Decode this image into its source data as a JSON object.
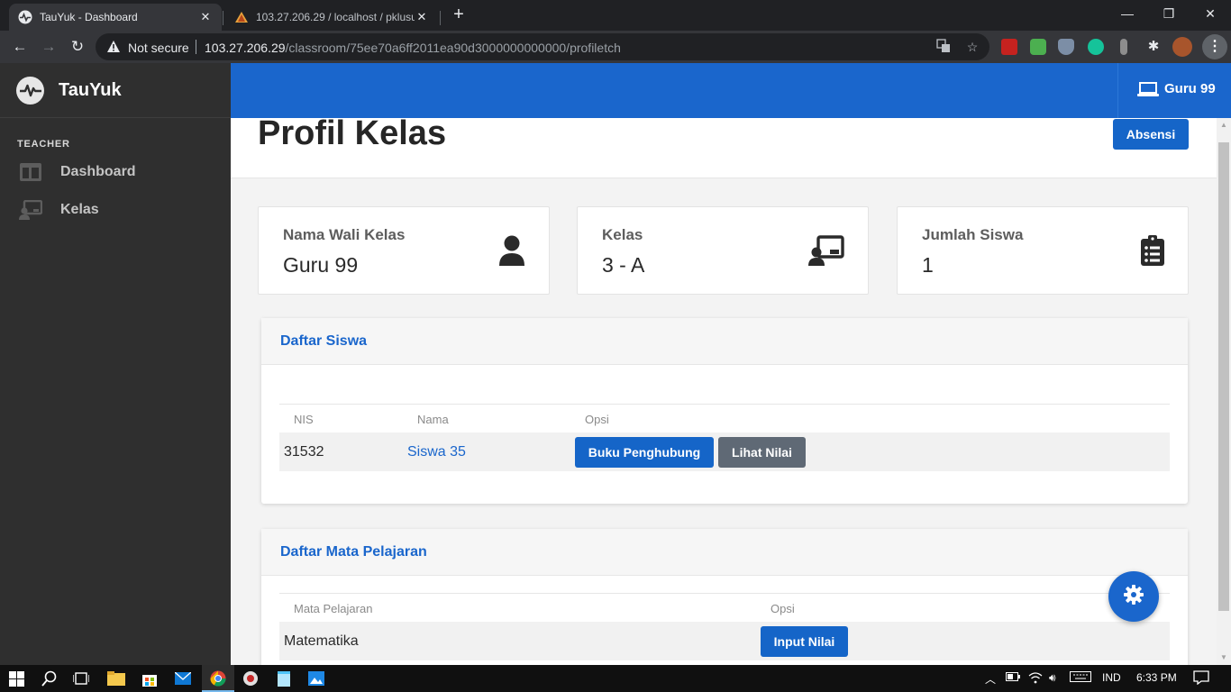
{
  "browser": {
    "tabs": [
      {
        "title": "TauYuk - Dashboard",
        "active": true
      },
      {
        "title": "103.27.206.29 / localhost / pklusu",
        "active": false
      }
    ],
    "omnibox": {
      "security": "Not secure",
      "host": "103.27.206.29",
      "path": "/classroom/75ee70a6ff2011ea90d3000000000000/profiletch"
    }
  },
  "app": {
    "brand": "TauYuk",
    "topbar_user": "Guru 99",
    "sidebar": {
      "heading": "TEACHER",
      "items": [
        {
          "label": "Dashboard",
          "icon": "dashboard-icon"
        },
        {
          "label": "Kelas",
          "icon": "classroom-icon"
        }
      ]
    }
  },
  "page": {
    "title": "Profil Kelas",
    "absensi_label": "Absensi",
    "stats": [
      {
        "label": "Nama Wali Kelas",
        "value": "Guru 99",
        "icon": "user-icon"
      },
      {
        "label": "Kelas",
        "value": "3 - A",
        "icon": "chalkboard-teacher-icon"
      },
      {
        "label": "Jumlah Siswa",
        "value": "1",
        "icon": "clipboard-list-icon"
      }
    ],
    "students": {
      "title": "Daftar Siswa",
      "columns": [
        "NIS",
        "Nama",
        "Opsi"
      ],
      "rows": [
        {
          "nis": "31532",
          "nama": "Siswa 35",
          "btn1": "Buku Penghubung",
          "btn2": "Lihat Nilai"
        }
      ]
    },
    "subjects": {
      "title": "Daftar Mata Pelajaran",
      "columns": [
        "Mata Pelajaran",
        "Opsi"
      ],
      "rows": [
        {
          "name": "Matematika",
          "btn": "Input Nilai"
        }
      ]
    }
  },
  "taskbar": {
    "language": "IND",
    "time": "6:33 PM"
  },
  "colors": {
    "primary": "#1a66cc",
    "sidebar": "#2f2f2f",
    "secondary_button": "#5f6975"
  }
}
